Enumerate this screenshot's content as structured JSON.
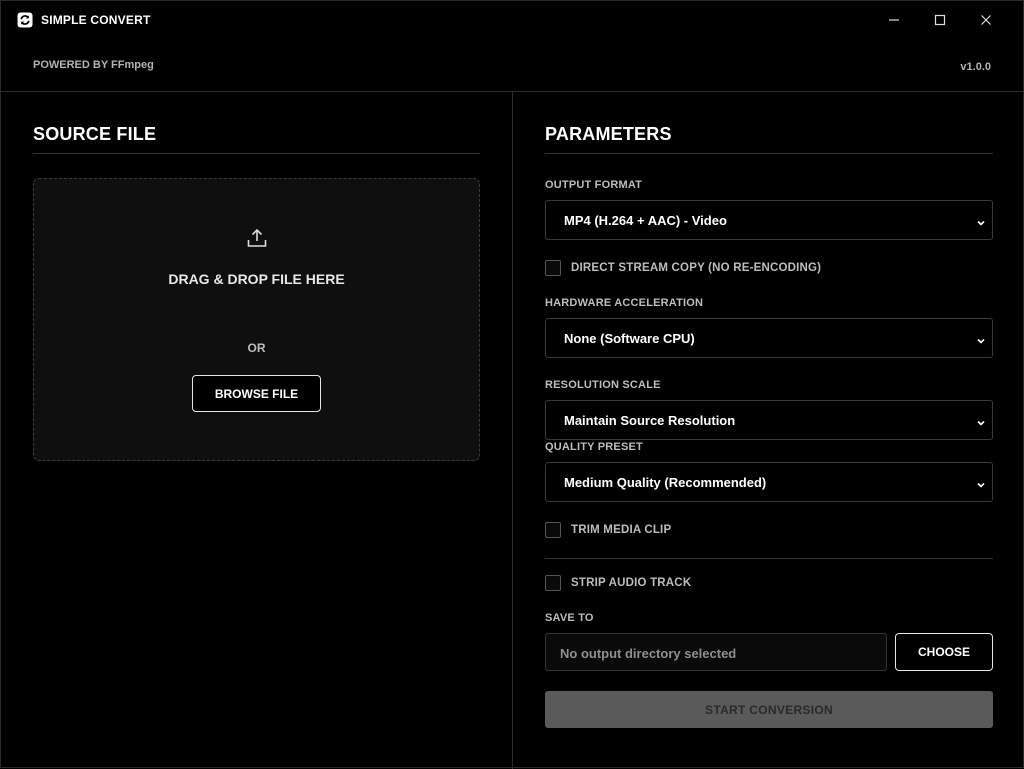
{
  "titlebar": {
    "app_icon": "refresh-icon",
    "title": "SIMPLE CONVERT",
    "controls": [
      "minimize-icon",
      "maximize-icon",
      "close-icon"
    ]
  },
  "header": {
    "powered_by": "POWERED BY FFmpeg",
    "version": "v1.0.0"
  },
  "source": {
    "title": "SOURCE FILE",
    "upload_icon": "upload-icon",
    "drop_text": "DRAG & DROP FILE HERE",
    "or_text": "OR",
    "browse_label": "BROWSE FILE"
  },
  "parameters": {
    "title": "PARAMETERS",
    "output_format": {
      "label": "OUTPUT FORMAT",
      "value": "MP4 (H.264 + AAC) - Video"
    },
    "direct_stream_copy": {
      "label": "DIRECT STREAM COPY (NO RE-ENCODING)",
      "checked": false
    },
    "hardware_acceleration": {
      "label": "HARDWARE ACCELERATION",
      "value": "None (Software CPU)"
    },
    "resolution_scale": {
      "label": "RESOLUTION SCALE",
      "value": "Maintain Source Resolution"
    },
    "quality_preset": {
      "label": "QUALITY PRESET",
      "value": "Medium Quality (Recommended)"
    },
    "trim_media_clip": {
      "label": "TRIM MEDIA CLIP",
      "checked": false
    },
    "strip_audio_track": {
      "label": "STRIP AUDIO TRACK",
      "checked": false
    },
    "save_to": {
      "label": "SAVE TO",
      "placeholder": "No output directory selected",
      "choose_label": "CHOOSE"
    },
    "start_label": "START CONVERSION"
  },
  "colors": {
    "background": "#000000",
    "panel": "#0f0f0f",
    "border": "#3a3a3a",
    "label": "#bdbdbd",
    "disabled_button": "#5a5a5a"
  }
}
